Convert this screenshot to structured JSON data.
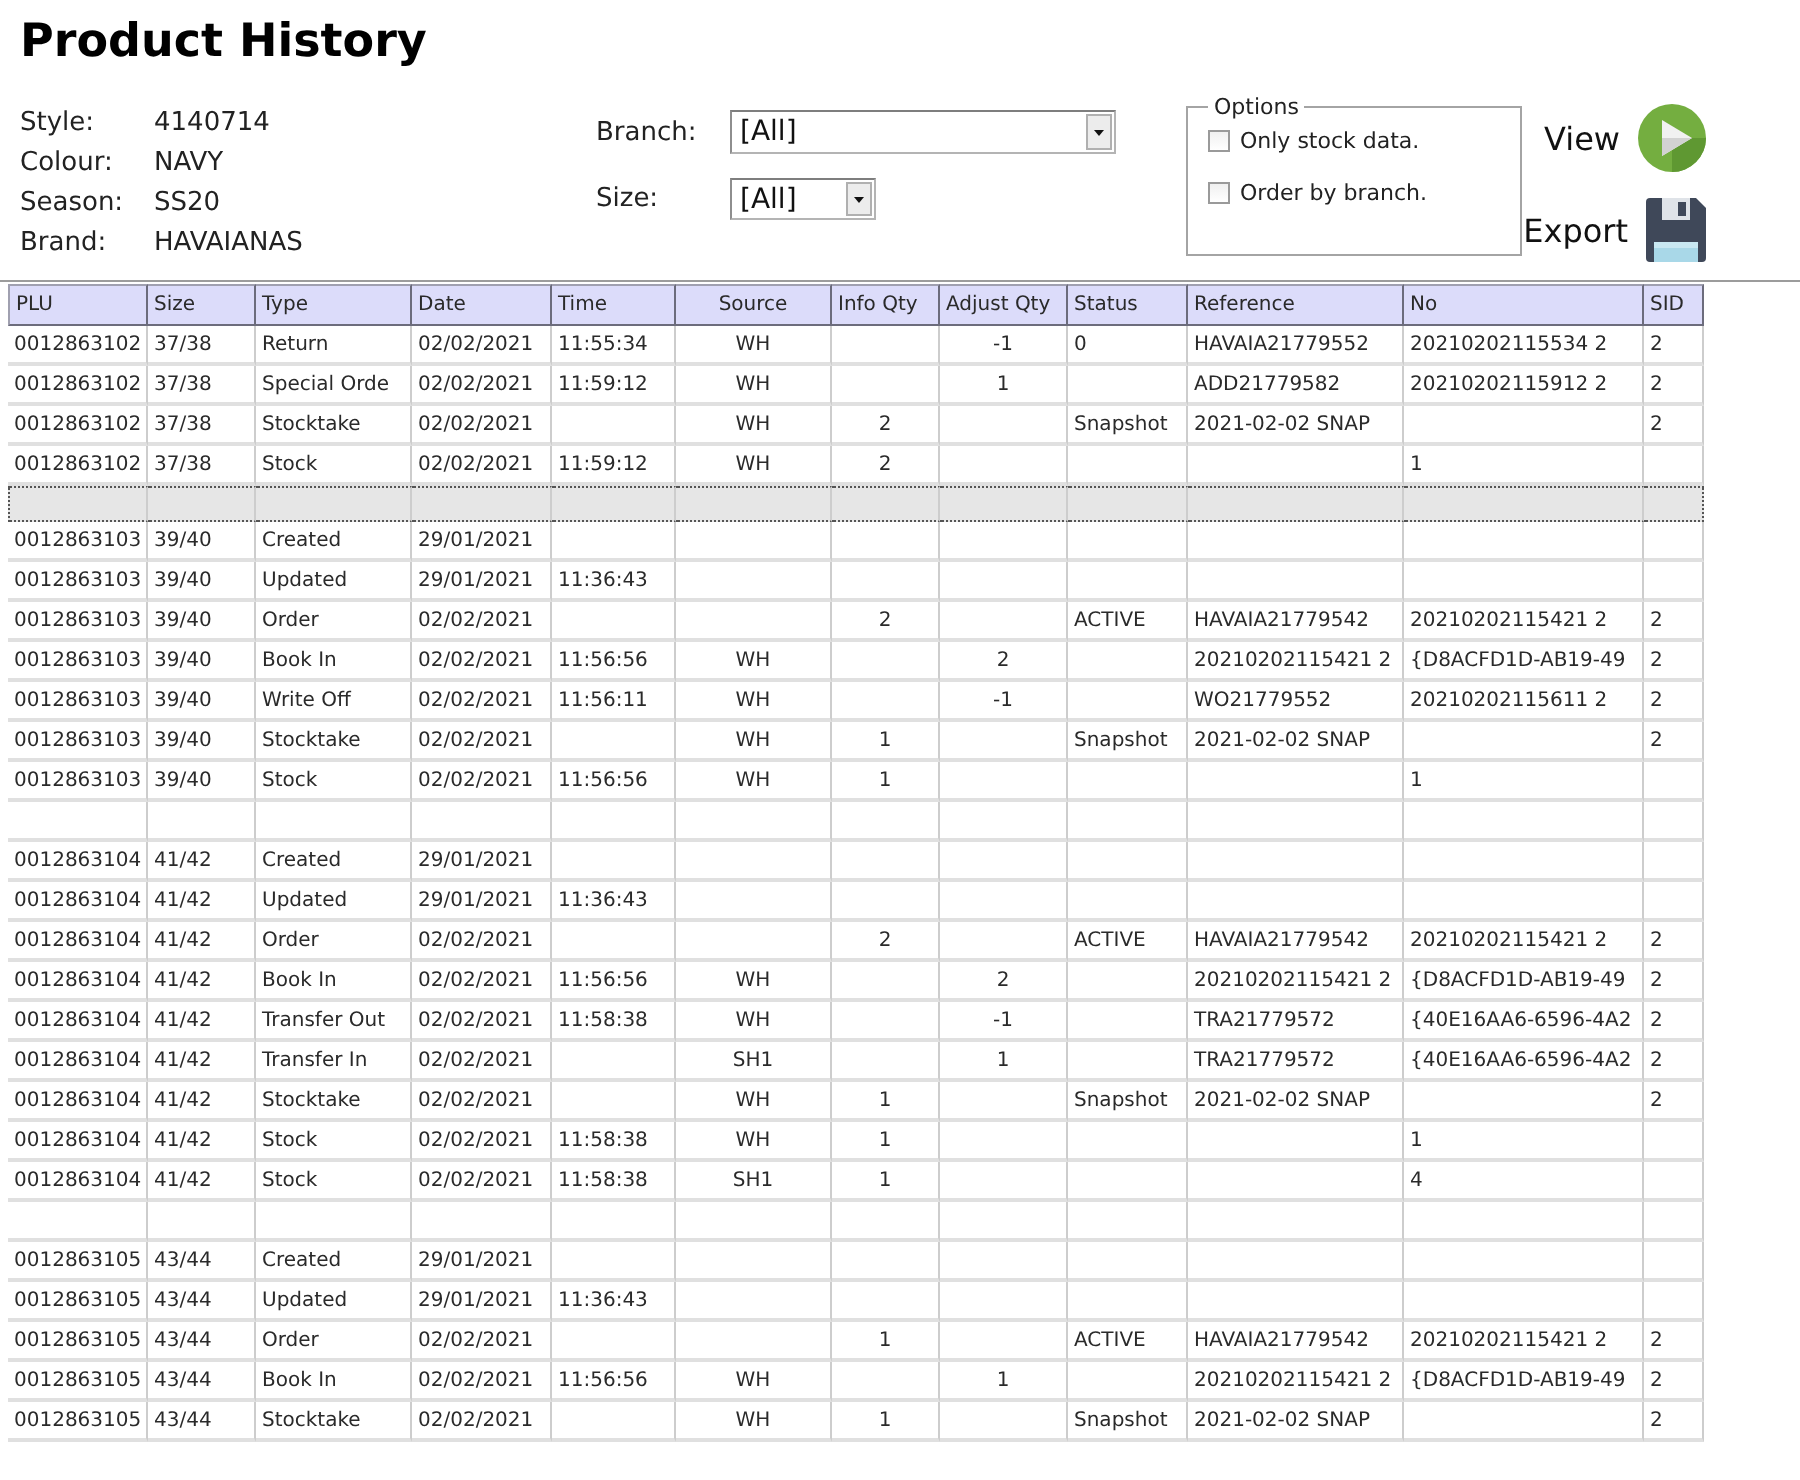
{
  "title": "Product History",
  "details": [
    {
      "label": "Style:",
      "value": "4140714"
    },
    {
      "label": "Colour:",
      "value": "NAVY"
    },
    {
      "label": "Season:",
      "value": "SS20"
    },
    {
      "label": "Brand:",
      "value": "HAVAIANAS"
    }
  ],
  "filters": {
    "branch": {
      "label": "Branch:",
      "value": "[All]"
    },
    "size": {
      "label": "Size:",
      "value": "[All]"
    }
  },
  "options": {
    "legend": "Options",
    "items": [
      {
        "label": "Only stock data.",
        "checked": false
      },
      {
        "label": "Order by branch.",
        "checked": false
      }
    ]
  },
  "actions": [
    {
      "label": "View",
      "kind": "view"
    },
    {
      "label": "Export",
      "kind": "export"
    }
  ],
  "table": {
    "columns": [
      "PLU",
      "Size",
      "Type",
      "Date",
      "Time",
      "Source",
      "Info Qty",
      "Adjust Qty",
      "Status",
      "Reference",
      "No",
      "SID"
    ],
    "rows": [
      {
        "selected": false,
        "plu": "0012863102",
        "size": "37/38",
        "type": "Return",
        "date": "02/02/2021",
        "time": "11:55:34",
        "source": "WH",
        "adjust_qty": "-1",
        "status": "0",
        "reference": "HAVAIA21779552",
        "no": "20210202115534 2",
        "sid": "2"
      },
      {
        "selected": false,
        "plu": "0012863102",
        "size": "37/38",
        "type": "Special Orde",
        "date": "02/02/2021",
        "time": "11:59:12",
        "source": "WH",
        "adjust_qty": "1",
        "reference": "ADD21779582",
        "no": "20210202115912 2",
        "sid": "2"
      },
      {
        "selected": false,
        "plu": "0012863102",
        "size": "37/38",
        "type": "Stocktake",
        "date": "02/02/2021",
        "source": "WH",
        "info_qty": "2",
        "status": "Snapshot",
        "reference": "2021-02-02 SNAP",
        "sid": "2"
      },
      {
        "selected": false,
        "plu": "0012863102",
        "size": "37/38",
        "type": "Stock",
        "date": "02/02/2021",
        "time": "11:59:12",
        "source": "WH",
        "info_qty": "2",
        "no": "1"
      },
      {
        "selected": true
      },
      {
        "selected": false,
        "plu": "0012863103",
        "size": "39/40",
        "type": "Created",
        "date": "29/01/2021"
      },
      {
        "selected": false,
        "plu": "0012863103",
        "size": "39/40",
        "type": "Updated",
        "date": "29/01/2021",
        "time": "11:36:43"
      },
      {
        "selected": false,
        "plu": "0012863103",
        "size": "39/40",
        "type": "Order",
        "date": "02/02/2021",
        "info_qty": "2",
        "status": "ACTIVE",
        "reference": "HAVAIA21779542",
        "no": "20210202115421 2",
        "sid": "2"
      },
      {
        "selected": false,
        "plu": "0012863103",
        "size": "39/40",
        "type": "Book In",
        "date": "02/02/2021",
        "time": "11:56:56",
        "source": "WH",
        "adjust_qty": "2",
        "reference": "20210202115421 2",
        "no": "{D8ACFD1D-AB19-49",
        "sid": "2"
      },
      {
        "selected": false,
        "plu": "0012863103",
        "size": "39/40",
        "type": "Write Off",
        "date": "02/02/2021",
        "time": "11:56:11",
        "source": "WH",
        "adjust_qty": "-1",
        "reference": "WO21779552",
        "no": "20210202115611 2",
        "sid": "2"
      },
      {
        "selected": false,
        "plu": "0012863103",
        "size": "39/40",
        "type": "Stocktake",
        "date": "02/02/2021",
        "source": "WH",
        "info_qty": "1",
        "status": "Snapshot",
        "reference": "2021-02-02 SNAP",
        "sid": "2"
      },
      {
        "selected": false,
        "plu": "0012863103",
        "size": "39/40",
        "type": "Stock",
        "date": "02/02/2021",
        "time": "11:56:56",
        "source": "WH",
        "info_qty": "1",
        "no": "1"
      },
      {
        "selected": false
      },
      {
        "selected": false,
        "plu": "0012863104",
        "size": "41/42",
        "type": "Created",
        "date": "29/01/2021"
      },
      {
        "selected": false,
        "plu": "0012863104",
        "size": "41/42",
        "type": "Updated",
        "date": "29/01/2021",
        "time": "11:36:43"
      },
      {
        "selected": false,
        "plu": "0012863104",
        "size": "41/42",
        "type": "Order",
        "date": "02/02/2021",
        "info_qty": "2",
        "status": "ACTIVE",
        "reference": "HAVAIA21779542",
        "no": "20210202115421 2",
        "sid": "2"
      },
      {
        "selected": false,
        "plu": "0012863104",
        "size": "41/42",
        "type": "Book In",
        "date": "02/02/2021",
        "time": "11:56:56",
        "source": "WH",
        "adjust_qty": "2",
        "reference": "20210202115421 2",
        "no": "{D8ACFD1D-AB19-49",
        "sid": "2"
      },
      {
        "selected": false,
        "plu": "0012863104",
        "size": "41/42",
        "type": "Transfer Out",
        "date": "02/02/2021",
        "time": "11:58:38",
        "source": "WH",
        "adjust_qty": "-1",
        "reference": "TRA21779572",
        "no": "{40E16AA6-6596-4A2",
        "sid": "2"
      },
      {
        "selected": false,
        "plu": "0012863104",
        "size": "41/42",
        "type": "Transfer In",
        "date": "02/02/2021",
        "source": "SH1",
        "adjust_qty": "1",
        "reference": "TRA21779572",
        "no": "{40E16AA6-6596-4A2",
        "sid": "2"
      },
      {
        "selected": false,
        "plu": "0012863104",
        "size": "41/42",
        "type": "Stocktake",
        "date": "02/02/2021",
        "source": "WH",
        "info_qty": "1",
        "status": "Snapshot",
        "reference": "2021-02-02 SNAP",
        "sid": "2"
      },
      {
        "selected": false,
        "plu": "0012863104",
        "size": "41/42",
        "type": "Stock",
        "date": "02/02/2021",
        "time": "11:58:38",
        "source": "WH",
        "info_qty": "1",
        "no": "1"
      },
      {
        "selected": false,
        "plu": "0012863104",
        "size": "41/42",
        "type": "Stock",
        "date": "02/02/2021",
        "time": "11:58:38",
        "source": "SH1",
        "info_qty": "1",
        "no": "4"
      },
      {
        "selected": false
      },
      {
        "selected": false,
        "plu": "0012863105",
        "size": "43/44",
        "type": "Created",
        "date": "29/01/2021"
      },
      {
        "selected": false,
        "plu": "0012863105",
        "size": "43/44",
        "type": "Updated",
        "date": "29/01/2021",
        "time": "11:36:43"
      },
      {
        "selected": false,
        "plu": "0012863105",
        "size": "43/44",
        "type": "Order",
        "date": "02/02/2021",
        "info_qty": "1",
        "status": "ACTIVE",
        "reference": "HAVAIA21779542",
        "no": "20210202115421 2",
        "sid": "2"
      },
      {
        "selected": false,
        "plu": "0012863105",
        "size": "43/44",
        "type": "Book In",
        "date": "02/02/2021",
        "time": "11:56:56",
        "source": "WH",
        "adjust_qty": "1",
        "reference": "20210202115421 2",
        "no": "{D8ACFD1D-AB19-49",
        "sid": "2"
      },
      {
        "selected": false,
        "plu": "0012863105",
        "size": "43/44",
        "type": "Stocktake",
        "date": "02/02/2021",
        "source": "WH",
        "info_qty": "1",
        "status": "Snapshot",
        "reference": "2021-02-02 SNAP",
        "sid": "2"
      }
    ]
  }
}
